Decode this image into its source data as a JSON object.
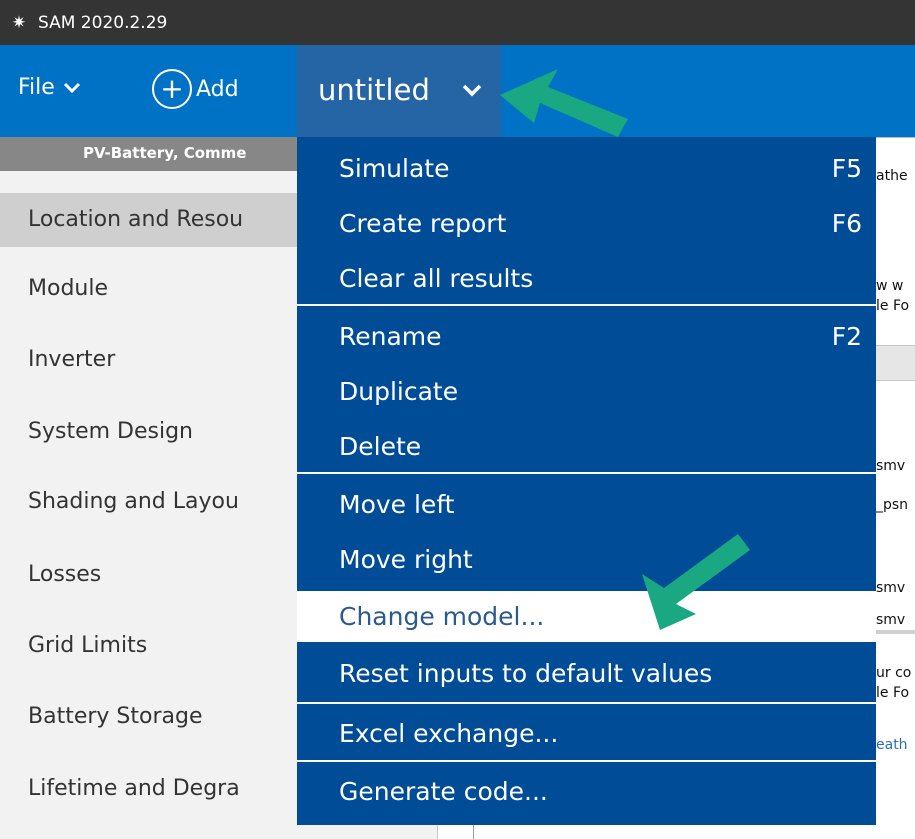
{
  "window": {
    "title": "SAM 2020.2.29"
  },
  "toolbar": {
    "file_label": "File",
    "add_label": "Add",
    "case_name": "untitled"
  },
  "sidebar": {
    "config_header": "PV-Battery, Comme",
    "items": [
      {
        "label": "Location and Resou"
      },
      {
        "label": "Module"
      },
      {
        "label": "Inverter"
      },
      {
        "label": "System Design"
      },
      {
        "label": "Shading and Layou"
      },
      {
        "label": "Losses"
      },
      {
        "label": "Grid Limits"
      },
      {
        "label": "Battery Storage"
      },
      {
        "label": "Lifetime and Degra"
      }
    ],
    "selected_index": 0
  },
  "menu": {
    "items": [
      {
        "label": "Simulate",
        "shortcut": "F5"
      },
      {
        "label": "Create report",
        "shortcut": "F6"
      },
      {
        "label": "Clear all results",
        "shortcut": ""
      },
      {
        "label": "Rename",
        "shortcut": "F2"
      },
      {
        "label": "Duplicate",
        "shortcut": ""
      },
      {
        "label": "Delete",
        "shortcut": ""
      },
      {
        "label": "Move left",
        "shortcut": ""
      },
      {
        "label": "Move right",
        "shortcut": ""
      },
      {
        "label": "Change model...",
        "shortcut": ""
      },
      {
        "label": "Reset inputs to default values",
        "shortcut": ""
      },
      {
        "label": "Excel exchange...",
        "shortcut": ""
      },
      {
        "label": "Generate code...",
        "shortcut": ""
      }
    ],
    "highlighted_index": 8
  },
  "background_peek": {
    "t1": "athe",
    "t2": "w w",
    "t3": "le Fo",
    "t4": "smv",
    "t5": "_psn",
    "t6": "smv",
    "t7": "smv",
    "t8": "ur co",
    "t9": "le Fo",
    "t10": "eath"
  },
  "colors": {
    "toolbar_blue": "#0072c6",
    "menu_blue": "#004c97",
    "case_tab_blue": "#2565a5",
    "arrow_green": "#19a882",
    "titlebar": "#343434"
  }
}
